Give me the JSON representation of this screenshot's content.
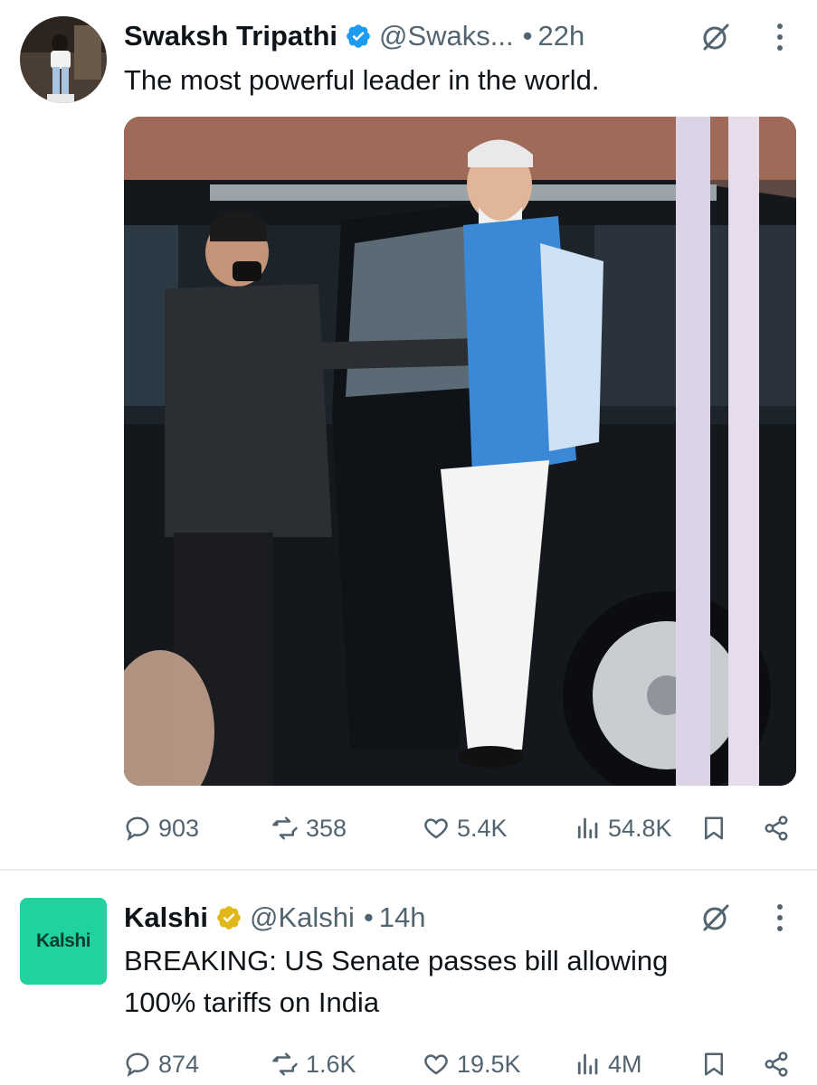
{
  "tweets": [
    {
      "author_name": "Swaksh Tripathi",
      "verified_badge": "blue-check",
      "handle": "@Swaks...",
      "time": "22h",
      "text_lines": [
        "The most powerful leader in the world."
      ],
      "has_media": true,
      "stats": {
        "replies": "903",
        "retweets": "358",
        "likes": "5.4K",
        "views": "54.8K"
      }
    },
    {
      "author_name": "Kalshi",
      "avatar_text": "Kalshi",
      "verified_badge": "gold-check",
      "handle": "@Kalshi",
      "time": "14h",
      "text_lines": [
        "BREAKING: US Senate passes bill allowing",
        "100% tariffs on India"
      ],
      "has_media": false,
      "stats": {
        "replies": "874",
        "retweets": "1.6K",
        "likes": "19.5K",
        "views": "4M"
      }
    }
  ],
  "dot_separator": "•",
  "colors": {
    "text_primary": "#0f1419",
    "text_secondary": "#536471",
    "verified_blue": "#1d9bf0",
    "verified_gold": "#e2b719",
    "kalshi_green": "#21d19f",
    "divider": "#e8ecef"
  },
  "icons": [
    "grok-icon",
    "more-icon",
    "reply-icon",
    "retweet-icon",
    "like-icon",
    "views-icon",
    "bookmark-icon",
    "share-icon"
  ]
}
